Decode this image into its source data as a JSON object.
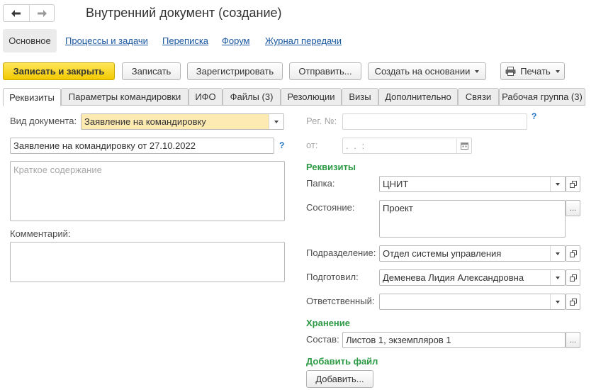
{
  "window": {
    "title": "Внутренний документ (создание)"
  },
  "nav": {
    "back_icon": "arrow-left-icon",
    "forward_icon": "arrow-right-icon"
  },
  "sections": [
    "Основное",
    "Процессы и задачи",
    "Переписка",
    "Форум",
    "Журнал передачи"
  ],
  "toolbar": {
    "save_close": "Записать и закрыть",
    "save": "Записать",
    "register": "Зарегистрировать",
    "send": "Отправить...",
    "create_based": "Создать на основании",
    "print": "Печать"
  },
  "tabs": [
    "Реквизиты",
    "Параметры командировки",
    "ИФО",
    "Файлы (3)",
    "Резолюции",
    "Визы",
    "Дополнительно",
    "Связи",
    "Рабочая группа (3)"
  ],
  "form": {
    "doc_type_label": "Вид документа:",
    "doc_type_value": "Заявление на командировку",
    "subject_value": "Заявление на командировку  от 27.10.2022",
    "summary_placeholder": "Краткое содержание",
    "comment_label": "Комментарий:",
    "reg_no_label": "Рег. №:",
    "reg_no_value": "",
    "date_label": "от:",
    "date_mask": " .  .     :  ",
    "help_mark": "?",
    "requisites_title": "Реквизиты",
    "folder_label": "Папка:",
    "folder_value": "ЦНИТ",
    "state_label": "Состояние:",
    "state_value": "Проект",
    "department_label": "Подразделение:",
    "department_value": "Отдел системы управления",
    "prepared_label": "Подготовил:",
    "prepared_value": "Деменева Лидия Александровна",
    "responsible_label": "Ответственный:",
    "responsible_value": "",
    "storage_title": "Хранение",
    "composition_label": "Состав:",
    "composition_value": "Листов 1, экземпляров 1",
    "add_file_title": "Добавить файл",
    "add_button": "Добавить...",
    "ellipsis": "..."
  },
  "colors": {
    "accent_yellow": "#f2ca00",
    "link": "#1a56a0",
    "section_green": "#2c9a44",
    "highlight_field": "#fde9b2"
  }
}
